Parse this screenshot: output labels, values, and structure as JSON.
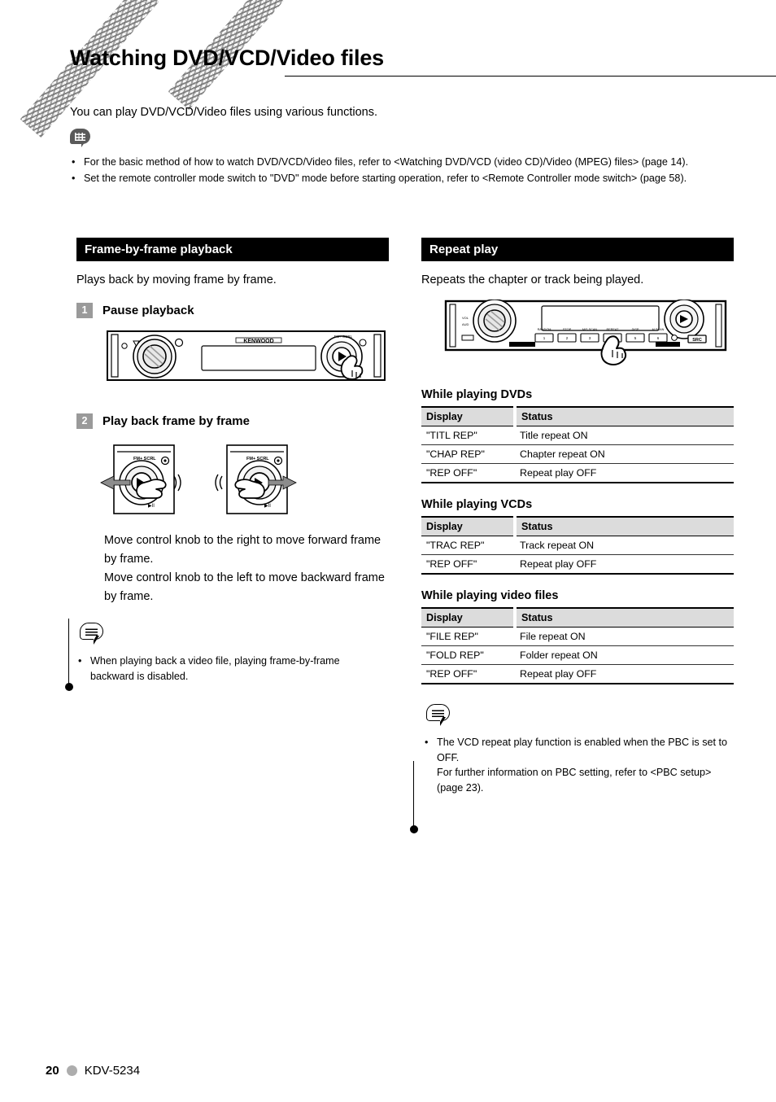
{
  "document": {
    "title": "Watching DVD/VCD/Video files",
    "intro": "You can play DVD/VCD/Video files using various functions.",
    "top_notes": [
      "For the basic method of how to watch DVD/VCD/Video files, refer to <Watching DVD/VCD (video CD)/Video (MPEG) files> (page 14).",
      "Set the remote controller mode switch to \"DVD\" mode before starting operation, refer to <Remote Controller mode switch> (page 58)."
    ],
    "bullet_marker": "•"
  },
  "left_column": {
    "heading": "Frame-by-frame playback",
    "lead": "Plays back by moving frame by frame.",
    "steps": [
      {
        "number": "1",
        "label": "Pause playback"
      },
      {
        "number": "2",
        "label": "Play back frame by frame"
      }
    ],
    "instructions": [
      "Move control knob to the right to move forward frame by frame.",
      "Move control knob to the left to move backward frame by frame."
    ],
    "note_marker": "•",
    "notes": [
      "When playing back a video file, playing frame-by-frame backward is disabled."
    ],
    "device_brand": "KENWOOD"
  },
  "right_column": {
    "heading": "Repeat play",
    "lead": "Repeats the chapter or track being played.",
    "tables": [
      {
        "title": "While playing DVDs",
        "columns": [
          "Display",
          "Status"
        ],
        "rows": [
          [
            "\"TITL REP\"",
            "Title repeat ON"
          ],
          [
            "\"CHAP REP\"",
            "Chapter repeat ON"
          ],
          [
            "\"REP OFF\"",
            "Repeat play OFF"
          ]
        ]
      },
      {
        "title": "While playing VCDs",
        "columns": [
          "Display",
          "Status"
        ],
        "rows": [
          [
            "\"TRAC REP\"",
            "Track repeat ON"
          ],
          [
            "\"REP OFF\"",
            "Repeat play OFF"
          ]
        ]
      },
      {
        "title": "While playing video files",
        "columns": [
          "Display",
          "Status"
        ],
        "rows": [
          [
            "\"FILE REP\"",
            "File repeat ON"
          ],
          [
            "\"FOLD REP\"",
            "Folder repeat ON"
          ],
          [
            "\"REP OFF\"",
            "Repeat play OFF"
          ]
        ]
      }
    ],
    "note_marker": "•",
    "notes": [
      "The VCD repeat play function is enabled when the PBC is set to OFF.",
      "For further information on PBC setting, refer to <PBC setup> (page 23)."
    ],
    "panel_button_label": "SRC"
  },
  "footer": {
    "page_number": "20",
    "model": "KDV-5234"
  },
  "colors": {
    "section_header_bg": "#000000",
    "section_header_text": "#ffffff",
    "step_badge_bg": "#9a9a9a",
    "table_header_bg": "#dcdcdc",
    "footer_dot": "#adadad"
  }
}
